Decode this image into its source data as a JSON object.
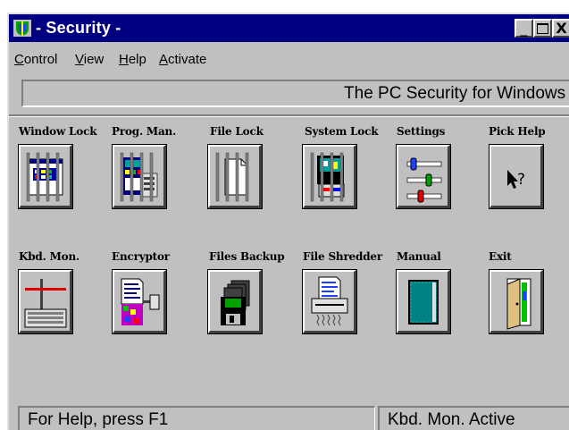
{
  "window": {
    "title": "- Security -",
    "minimize_glyph": "_",
    "close_glyph": "X"
  },
  "menu": {
    "items": [
      {
        "first": "C",
        "rest": "ontrol"
      },
      {
        "first": "V",
        "rest": "iew"
      },
      {
        "first": "H",
        "rest": "elp"
      },
      {
        "first": "A",
        "rest": "ctivate"
      }
    ]
  },
  "banner": {
    "text": "The PC Security for Windows p"
  },
  "tools": {
    "row1": [
      {
        "label": "Window Lock",
        "icon": "window-lock-icon"
      },
      {
        "label": "Prog. Man.",
        "icon": "program-manager-icon"
      },
      {
        "label": "File Lock",
        "icon": "file-lock-icon"
      },
      {
        "label": "System Lock",
        "icon": "system-lock-icon"
      },
      {
        "label": "Settings",
        "icon": "sliders-icon"
      },
      {
        "label": "Pick Help",
        "icon": "help-pointer-icon"
      }
    ],
    "row2": [
      {
        "label": "Kbd. Mon.",
        "icon": "keyboard-icon"
      },
      {
        "label": "Encryptor",
        "icon": "encryptor-icon"
      },
      {
        "label": "Files Backup",
        "icon": "backup-disk-icon"
      },
      {
        "label": "File Shredder",
        "icon": "shredder-icon"
      },
      {
        "label": "Manual",
        "icon": "manual-book-icon"
      },
      {
        "label": "Exit",
        "icon": "exit-door-icon"
      }
    ]
  },
  "help_glyph": "?",
  "status": {
    "left": "For Help, press F1",
    "right": "Kbd. Mon. Active"
  },
  "colors": {
    "titlebar": "#000080",
    "face": "#c0c0c0",
    "cropped_caption": "#e00000"
  }
}
